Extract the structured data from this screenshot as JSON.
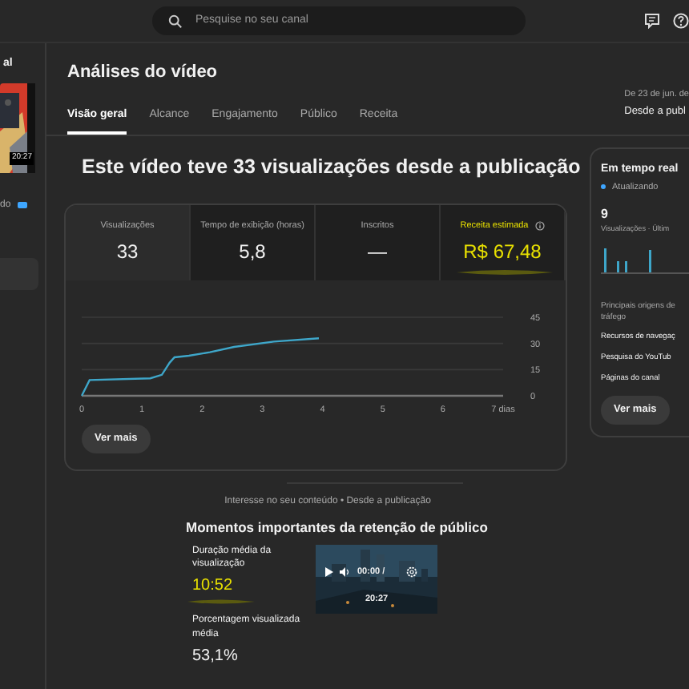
{
  "header": {
    "search_placeholder": "Pesquise no seu canal"
  },
  "sidebar": {
    "title": "al",
    "thumbnail_duration": "20:27",
    "caption": "do"
  },
  "page": {
    "title": "Análises do vídeo",
    "date_range": "De 23 de jun. de",
    "period": "Desde a publ",
    "tabs": [
      {
        "label": "Visão geral",
        "selected": true
      },
      {
        "label": "Alcance",
        "selected": false
      },
      {
        "label": "Engajamento",
        "selected": false
      },
      {
        "label": "Público",
        "selected": false
      },
      {
        "label": "Receita",
        "selected": false
      }
    ]
  },
  "headline": "Este vídeo teve 33 visualizações desde a publicação",
  "metrics": [
    {
      "label": "Visualizações",
      "value": "33",
      "selected": true,
      "highlighted": false
    },
    {
      "label": "Tempo de exibição (horas)",
      "value": "5,8",
      "selected": false,
      "highlighted": false
    },
    {
      "label": "Inscritos",
      "value": "—",
      "selected": false,
      "highlighted": false
    },
    {
      "label": "Receita estimada",
      "value": "R$ 67,48",
      "selected": false,
      "highlighted": true,
      "info": true
    }
  ],
  "chart_data": {
    "type": "line",
    "x": [
      0,
      0.13,
      1.14,
      1.33,
      1.46,
      1.54,
      1.78,
      2.13,
      2.53,
      3.19,
      3.94
    ],
    "series": [
      {
        "color": "#3ea6c9",
        "values": [
          0,
          9,
          10,
          12,
          19,
          22,
          23,
          25,
          28,
          31,
          33
        ]
      }
    ],
    "xlim": [
      0,
      7
    ],
    "ylim": [
      0,
      45
    ],
    "xticks": [
      0,
      1,
      2,
      3,
      4,
      5,
      6,
      {
        "value": 7,
        "label": "7 dias"
      }
    ],
    "yticks": [
      0,
      15,
      30,
      45
    ]
  },
  "more_button": "Ver mais",
  "realtime": {
    "title": "Em tempo real",
    "status": "Atualizando",
    "count": "9",
    "count_label": "Visualizações · Últim",
    "sources_title": "Principais origens de tráfego",
    "sources": [
      "Recursos de navegaç",
      "Pesquisa do YouTub",
      "Páginas do canal"
    ],
    "more_button": "Ver mais"
  },
  "retention": {
    "context": "Interesse no seu conteúdo • Desde a publicação",
    "title": "Momentos importantes da retenção de público",
    "stats": [
      {
        "label": "Duração média da visualização",
        "value": "10:52",
        "highlighted": true
      },
      {
        "label": "Porcentagem visualizada média",
        "value": "53,1%",
        "highlighted": false
      }
    ],
    "video": {
      "time": "00:00 /",
      "duration": "20:27"
    }
  }
}
